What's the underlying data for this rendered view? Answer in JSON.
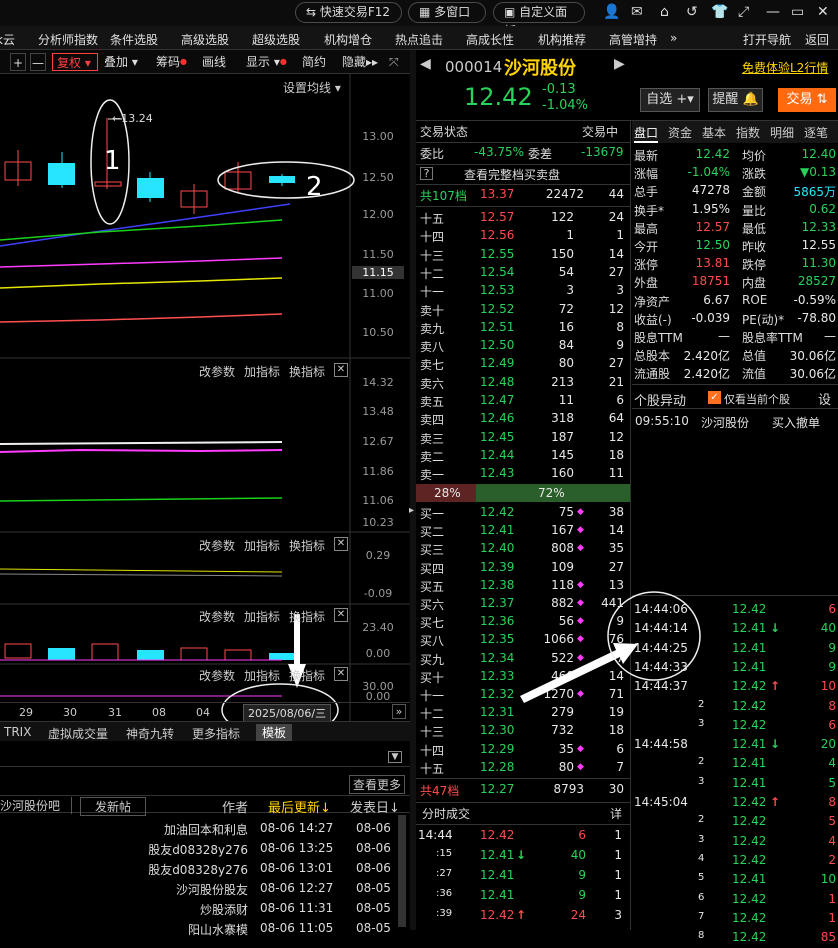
{
  "topbar": {
    "quick_trade": "快速交易F12",
    "multi_window": "多窗口",
    "custom_panel": "自定义面板"
  },
  "menu": [
    "k云",
    "分析师指数",
    "条件选股",
    "高级选股",
    "超级选股",
    "机构增仓",
    "热点追击",
    "高成长性",
    "机构推荐",
    "高管增持",
    "»",
    "打开导航",
    "返回"
  ],
  "chart_toolbar": {
    "plus": "+",
    "minus": "—",
    "fuquan": "复权",
    "overlay": "叠加",
    "chips": "筹码",
    "draw": "画线",
    "display": "显示",
    "simple": "简约",
    "hide": "隐藏▸▸"
  },
  "main_chart": {
    "ma_settings": "设置均线",
    "high_marker": "13.24",
    "axis": [
      "13.00",
      "12.50",
      "12.00",
      "11.50",
      "11.15",
      "11.00",
      "10.50"
    ],
    "annotation_1": "1",
    "annotation_2": "2"
  },
  "panel2": {
    "tools": [
      "改参数",
      "加指标",
      "换指标"
    ],
    "axis": [
      "14.32",
      "13.48",
      "12.67",
      "11.86",
      "11.06",
      "10.23"
    ]
  },
  "panel3": {
    "tools": [
      "改参数",
      "加指标",
      "换指标"
    ],
    "axis": [
      "0.29",
      "-0.09"
    ]
  },
  "panel4": {
    "tools": [
      "改参数",
      "加指标",
      "换指标"
    ],
    "axis": [
      "23.40",
      "0.00"
    ]
  },
  "panel5": {
    "tools": [
      "改参数",
      "加指标",
      "换指标"
    ],
    "axis": [
      "30.00",
      "0.00"
    ]
  },
  "date_axis": {
    "dates": [
      "29",
      "30",
      "31",
      "08",
      "04"
    ],
    "current": "2025/08/06/三"
  },
  "indicator_tabs": [
    "TRIX",
    "虚拟成交量",
    "神奇九转",
    "更多指标",
    "模板"
  ],
  "forum": {
    "more": "查看更多",
    "board": "沙河股份吧",
    "new_post": "发新帖",
    "headers": {
      "author": "作者",
      "last_update": "最后更新↓",
      "post_date": "发表日↓"
    },
    "rows": [
      {
        "author": "加油回本和利息",
        "update": "08-06 14:27",
        "date": "08-06"
      },
      {
        "author": "股友d08328y276",
        "update": "08-06 13:25",
        "date": "08-06"
      },
      {
        "author": "股友d08328y276",
        "update": "08-06 13:01",
        "date": "08-06"
      },
      {
        "author": "沙河股份股友",
        "update": "08-06 12:27",
        "date": "08-05"
      },
      {
        "author": "炒股添财",
        "update": "08-06 11:31",
        "date": "08-05"
      },
      {
        "author": "阳山水寨模",
        "update": "08-06 11:05",
        "date": "08-05"
      }
    ]
  },
  "stock": {
    "code": "000014",
    "name": "沙河股份",
    "promo": "免费体验L2行情",
    "price": "12.42",
    "change": "-0.13",
    "change_pct": "-1.04%",
    "btn_watch": "自选",
    "btn_alert": "提醒",
    "btn_trade": "交易"
  },
  "trade_status": {
    "label": "交易状态",
    "value": "交易中",
    "weibi_label": "委比",
    "weibi": "-43.75%",
    "weicha_label": "委差",
    "weicha": "-13679",
    "full_book": "查看完整档买卖盘"
  },
  "order_book": {
    "ask_total": {
      "label": "共107档",
      "price": "13.37",
      "vol": "22472",
      "n": "44"
    },
    "asks": [
      {
        "label": "十五",
        "price": "12.57",
        "vol": "122",
        "n": "24",
        "pc": "red"
      },
      {
        "label": "十四",
        "price": "12.56",
        "vol": "1",
        "n": "1",
        "pc": "red"
      },
      {
        "label": "十三",
        "price": "12.55",
        "vol": "150",
        "n": "14",
        "pc": "green"
      },
      {
        "label": "十二",
        "price": "12.54",
        "vol": "54",
        "n": "27",
        "pc": "green"
      },
      {
        "label": "十一",
        "price": "12.53",
        "vol": "3",
        "n": "3",
        "pc": "green"
      },
      {
        "label": "卖十",
        "price": "12.52",
        "vol": "72",
        "n": "12",
        "pc": "green"
      },
      {
        "label": "卖九",
        "price": "12.51",
        "vol": "16",
        "n": "8",
        "pc": "green"
      },
      {
        "label": "卖八",
        "price": "12.50",
        "vol": "84",
        "n": "9",
        "pc": "green"
      },
      {
        "label": "卖七",
        "price": "12.49",
        "vol": "80",
        "n": "27",
        "pc": "green"
      },
      {
        "label": "卖六",
        "price": "12.48",
        "vol": "213",
        "n": "21",
        "pc": "green"
      },
      {
        "label": "卖五",
        "price": "12.47",
        "vol": "11",
        "n": "6",
        "pc": "green"
      },
      {
        "label": "卖四",
        "price": "12.46",
        "vol": "318",
        "n": "64",
        "pc": "green"
      },
      {
        "label": "卖三",
        "price": "12.45",
        "vol": "187",
        "n": "12",
        "pc": "green"
      },
      {
        "label": "卖二",
        "price": "12.44",
        "vol": "145",
        "n": "18",
        "pc": "green"
      },
      {
        "label": "卖一",
        "price": "12.43",
        "vol": "160",
        "n": "11",
        "pc": "green"
      }
    ],
    "ratio_sell": "28%",
    "ratio_buy": "72%",
    "buy_fraction": 0.72,
    "bids": [
      {
        "label": "买一",
        "price": "12.42",
        "vol": "75",
        "n": "38",
        "dot": true
      },
      {
        "label": "买二",
        "price": "12.41",
        "vol": "167",
        "n": "14",
        "dot": true
      },
      {
        "label": "买三",
        "price": "12.40",
        "vol": "808",
        "n": "35",
        "dot": true
      },
      {
        "label": "买四",
        "price": "12.39",
        "vol": "109",
        "n": "27",
        "dot": false
      },
      {
        "label": "买五",
        "price": "12.38",
        "vol": "118",
        "n": "13",
        "dot": true
      },
      {
        "label": "买六",
        "price": "12.37",
        "vol": "882",
        "n": "441",
        "dot": true
      },
      {
        "label": "买七",
        "price": "12.36",
        "vol": "56",
        "n": "9",
        "dot": true
      },
      {
        "label": "买八",
        "price": "12.35",
        "vol": "1066",
        "n": "76",
        "dot": true
      },
      {
        "label": "买九",
        "price": "12.34",
        "vol": "522",
        "n": "7",
        "dot": true
      },
      {
        "label": "买十",
        "price": "12.33",
        "vol": "460",
        "n": "14",
        "dot": false
      },
      {
        "label": "十一",
        "price": "12.32",
        "vol": "1270",
        "n": "71",
        "dot": true
      },
      {
        "label": "十二",
        "price": "12.31",
        "vol": "279",
        "n": "19",
        "dot": false
      },
      {
        "label": "十三",
        "price": "12.30",
        "vol": "732",
        "n": "18",
        "dot": false
      },
      {
        "label": "十四",
        "price": "12.29",
        "vol": "35",
        "n": "6",
        "dot": true
      },
      {
        "label": "十五",
        "price": "12.28",
        "vol": "80",
        "n": "7",
        "dot": true
      }
    ],
    "bid_total": {
      "label": "共47档",
      "price": "12.27",
      "vol": "8793",
      "n": "30"
    }
  },
  "ticks_label": {
    "title": "分时成交",
    "detail": "详"
  },
  "left_ticks": [
    {
      "time": "14:44",
      "price": "12.42",
      "arrow": "",
      "vol": "6",
      "n": "1",
      "vc": "red"
    },
    {
      "time": ":15",
      "price": "12.41",
      "arrow": "↓",
      "vol": "40",
      "n": "1",
      "vc": "green"
    },
    {
      "time": ":27",
      "price": "12.41",
      "arrow": "",
      "vol": "9",
      "n": "1",
      "vc": "green"
    },
    {
      "time": ":36",
      "price": "12.41",
      "arrow": "",
      "vol": "9",
      "n": "1",
      "vc": "green"
    },
    {
      "time": ":39",
      "price": "12.42",
      "arrow": "↑",
      "vol": "24",
      "n": "3",
      "vc": "red"
    }
  ],
  "tabs": [
    "盘口",
    "资金",
    "基本",
    "指数",
    "明细",
    "逐笔"
  ],
  "quote": [
    {
      "l1": "最新",
      "v1": "12.42",
      "c1": "green",
      "l2": "均价",
      "v2": "12.40",
      "c2": "green"
    },
    {
      "l1": "涨幅",
      "v1": "-1.04%",
      "c1": "green",
      "l2": "涨跌",
      "v2": "▼0.13",
      "c2": "green"
    },
    {
      "l1": "总手",
      "v1": "47278",
      "c1": "white",
      "l2": "金额",
      "v2": "5865万",
      "c2": "cyan"
    },
    {
      "l1": "换手*",
      "v1": "1.95%",
      "c1": "white",
      "l2": "量比",
      "v2": "0.62",
      "c2": "green"
    },
    {
      "l1": "最高",
      "v1": "12.57",
      "c1": "red",
      "l2": "最低",
      "v2": "12.33",
      "c2": "green"
    },
    {
      "l1": "今开",
      "v1": "12.50",
      "c1": "green",
      "l2": "昨收",
      "v2": "12.55",
      "c2": "white"
    },
    {
      "l1": "涨停",
      "v1": "13.81",
      "c1": "red",
      "l2": "跌停",
      "v2": "11.30",
      "c2": "green"
    },
    {
      "l1": "外盘",
      "v1": "18751",
      "c1": "red",
      "l2": "内盘",
      "v2": "28527",
      "c2": "green"
    },
    {
      "l1": "净资产",
      "v1": "6.67",
      "c1": "white",
      "l2": "ROE",
      "v2": "-0.59%",
      "c2": "white"
    },
    {
      "l1": "收益(-)",
      "v1": "-0.039",
      "c1": "white",
      "l2": "PE(动)*",
      "v2": "-78.80",
      "c2": "white"
    },
    {
      "l1": "股息TTM",
      "v1": "—",
      "c1": "white",
      "l2": "股息率TTM",
      "v2": "—",
      "c2": "white"
    },
    {
      "l1": "总股本",
      "v1": "2.420亿",
      "c1": "white",
      "l2": "总值",
      "v2": "30.06亿",
      "c2": "white"
    },
    {
      "l1": "流通股",
      "v1": "2.420亿",
      "c1": "white",
      "l2": "流值",
      "v2": "30.06亿",
      "c2": "white"
    }
  ],
  "movement": {
    "title": "个股异动",
    "only_current": "仅看当前个股",
    "settings": "设",
    "time": "09:55:10",
    "name": "沙河股份",
    "event": "买入撤单"
  },
  "right_ticks": [
    {
      "time": "14:44:06",
      "price": "12.42",
      "arrow": "",
      "vol": "6",
      "vc": "red"
    },
    {
      "time": "14:44:14",
      "price": "12.41",
      "arrow": "↓",
      "vol": "40",
      "vc": "green"
    },
    {
      "time": "14:44:25",
      "price": "12.41",
      "arrow": "",
      "vol": "9",
      "vc": "green"
    },
    {
      "time": "14:44:33",
      "price": "12.41",
      "arrow": "",
      "vol": "9",
      "vc": "green"
    },
    {
      "time": "14:44:37",
      "price": "12.42",
      "arrow": "↑",
      "vol": "10",
      "vc": "red"
    },
    {
      "time": "2",
      "price": "12.42",
      "arrow": "",
      "vol": "8",
      "vc": "red"
    },
    {
      "time": "3",
      "price": "12.42",
      "arrow": "",
      "vol": "6",
      "vc": "red"
    },
    {
      "time": "14:44:58",
      "price": "12.41",
      "arrow": "↓",
      "vol": "20",
      "vc": "green"
    },
    {
      "time": "2",
      "price": "12.41",
      "arrow": "",
      "vol": "4",
      "vc": "green"
    },
    {
      "time": "3",
      "price": "12.41",
      "arrow": "",
      "vol": "5",
      "vc": "green"
    },
    {
      "time": "14:45:04",
      "price": "12.42",
      "arrow": "↑",
      "vol": "8",
      "vc": "red"
    },
    {
      "time": "2",
      "price": "12.42",
      "arrow": "",
      "vol": "5",
      "vc": "red"
    },
    {
      "time": "3",
      "price": "12.42",
      "arrow": "",
      "vol": "4",
      "vc": "red"
    },
    {
      "time": "4",
      "price": "12.42",
      "arrow": "",
      "vol": "2",
      "vc": "red"
    },
    {
      "time": "5",
      "price": "12.41",
      "arrow": "",
      "vol": "10",
      "vc": "green"
    },
    {
      "time": "6",
      "price": "12.42",
      "arrow": "",
      "vol": "1",
      "vc": "red"
    },
    {
      "time": "7",
      "price": "12.42",
      "arrow": "",
      "vol": "1",
      "vc": "red"
    },
    {
      "time": "8",
      "price": "12.42",
      "arrow": "",
      "vol": "85",
      "vc": "red"
    }
  ]
}
